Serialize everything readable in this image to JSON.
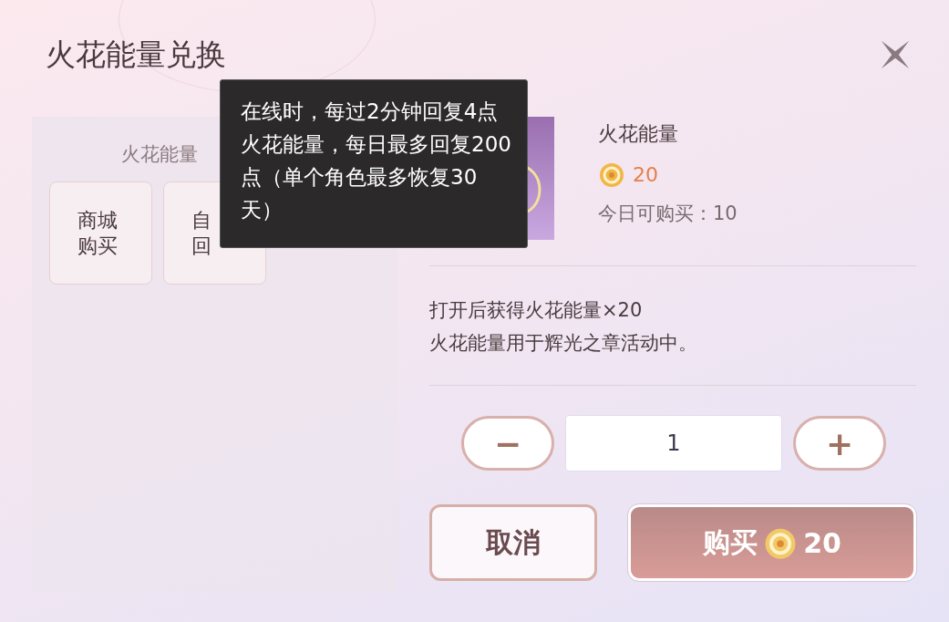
{
  "dialog": {
    "title": "火花能量兑换"
  },
  "sources_panel": {
    "title": "火花能量",
    "sources": [
      {
        "lines": [
          "商城",
          "购买"
        ]
      },
      {
        "lines": [
          "自",
          "回"
        ]
      }
    ]
  },
  "tooltip": {
    "text": "在线时，每过2分钟回复4点火花能量，每日最多回复200点（单个角色最多恢复30天）"
  },
  "item": {
    "name": "火花能量",
    "price": "20",
    "daily_limit": "今日可购买：10",
    "description": [
      "打开后获得火花能量×20",
      "火花能量用于辉光之章活动中。"
    ]
  },
  "quantity": {
    "minus": "−",
    "value": "1",
    "plus": "+"
  },
  "buttons": {
    "cancel": "取消",
    "buy": "购买",
    "buy_price": "20"
  }
}
